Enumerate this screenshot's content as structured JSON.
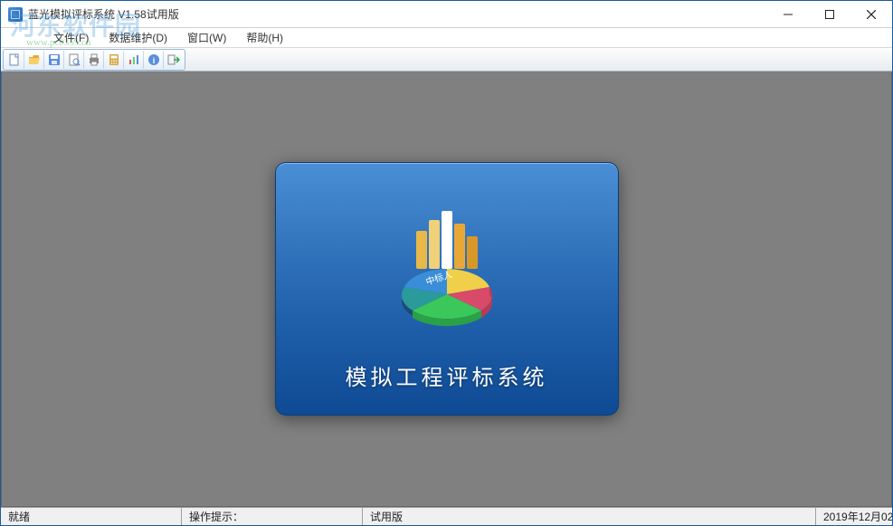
{
  "window": {
    "title": "蓝光模拟评标系统  V1.58试用版"
  },
  "watermark": {
    "main": "河东软件园",
    "sub": "www.pc0359.cn"
  },
  "menu": {
    "file": "文件(F)",
    "data": "数据维护(D)",
    "window": "窗口(W)",
    "help": "帮助(H)"
  },
  "splash": {
    "pie_label": "中标人",
    "title": "模拟工程评标系统"
  },
  "status": {
    "ready": "就绪",
    "hint_label": "操作提示：",
    "edition": "试用版",
    "date": "2019年12月02"
  },
  "colors": {
    "frame": "#1a5a9e",
    "content_bg": "#808080",
    "splash_top": "#4a8fd6",
    "splash_bottom": "#0f4a94"
  }
}
